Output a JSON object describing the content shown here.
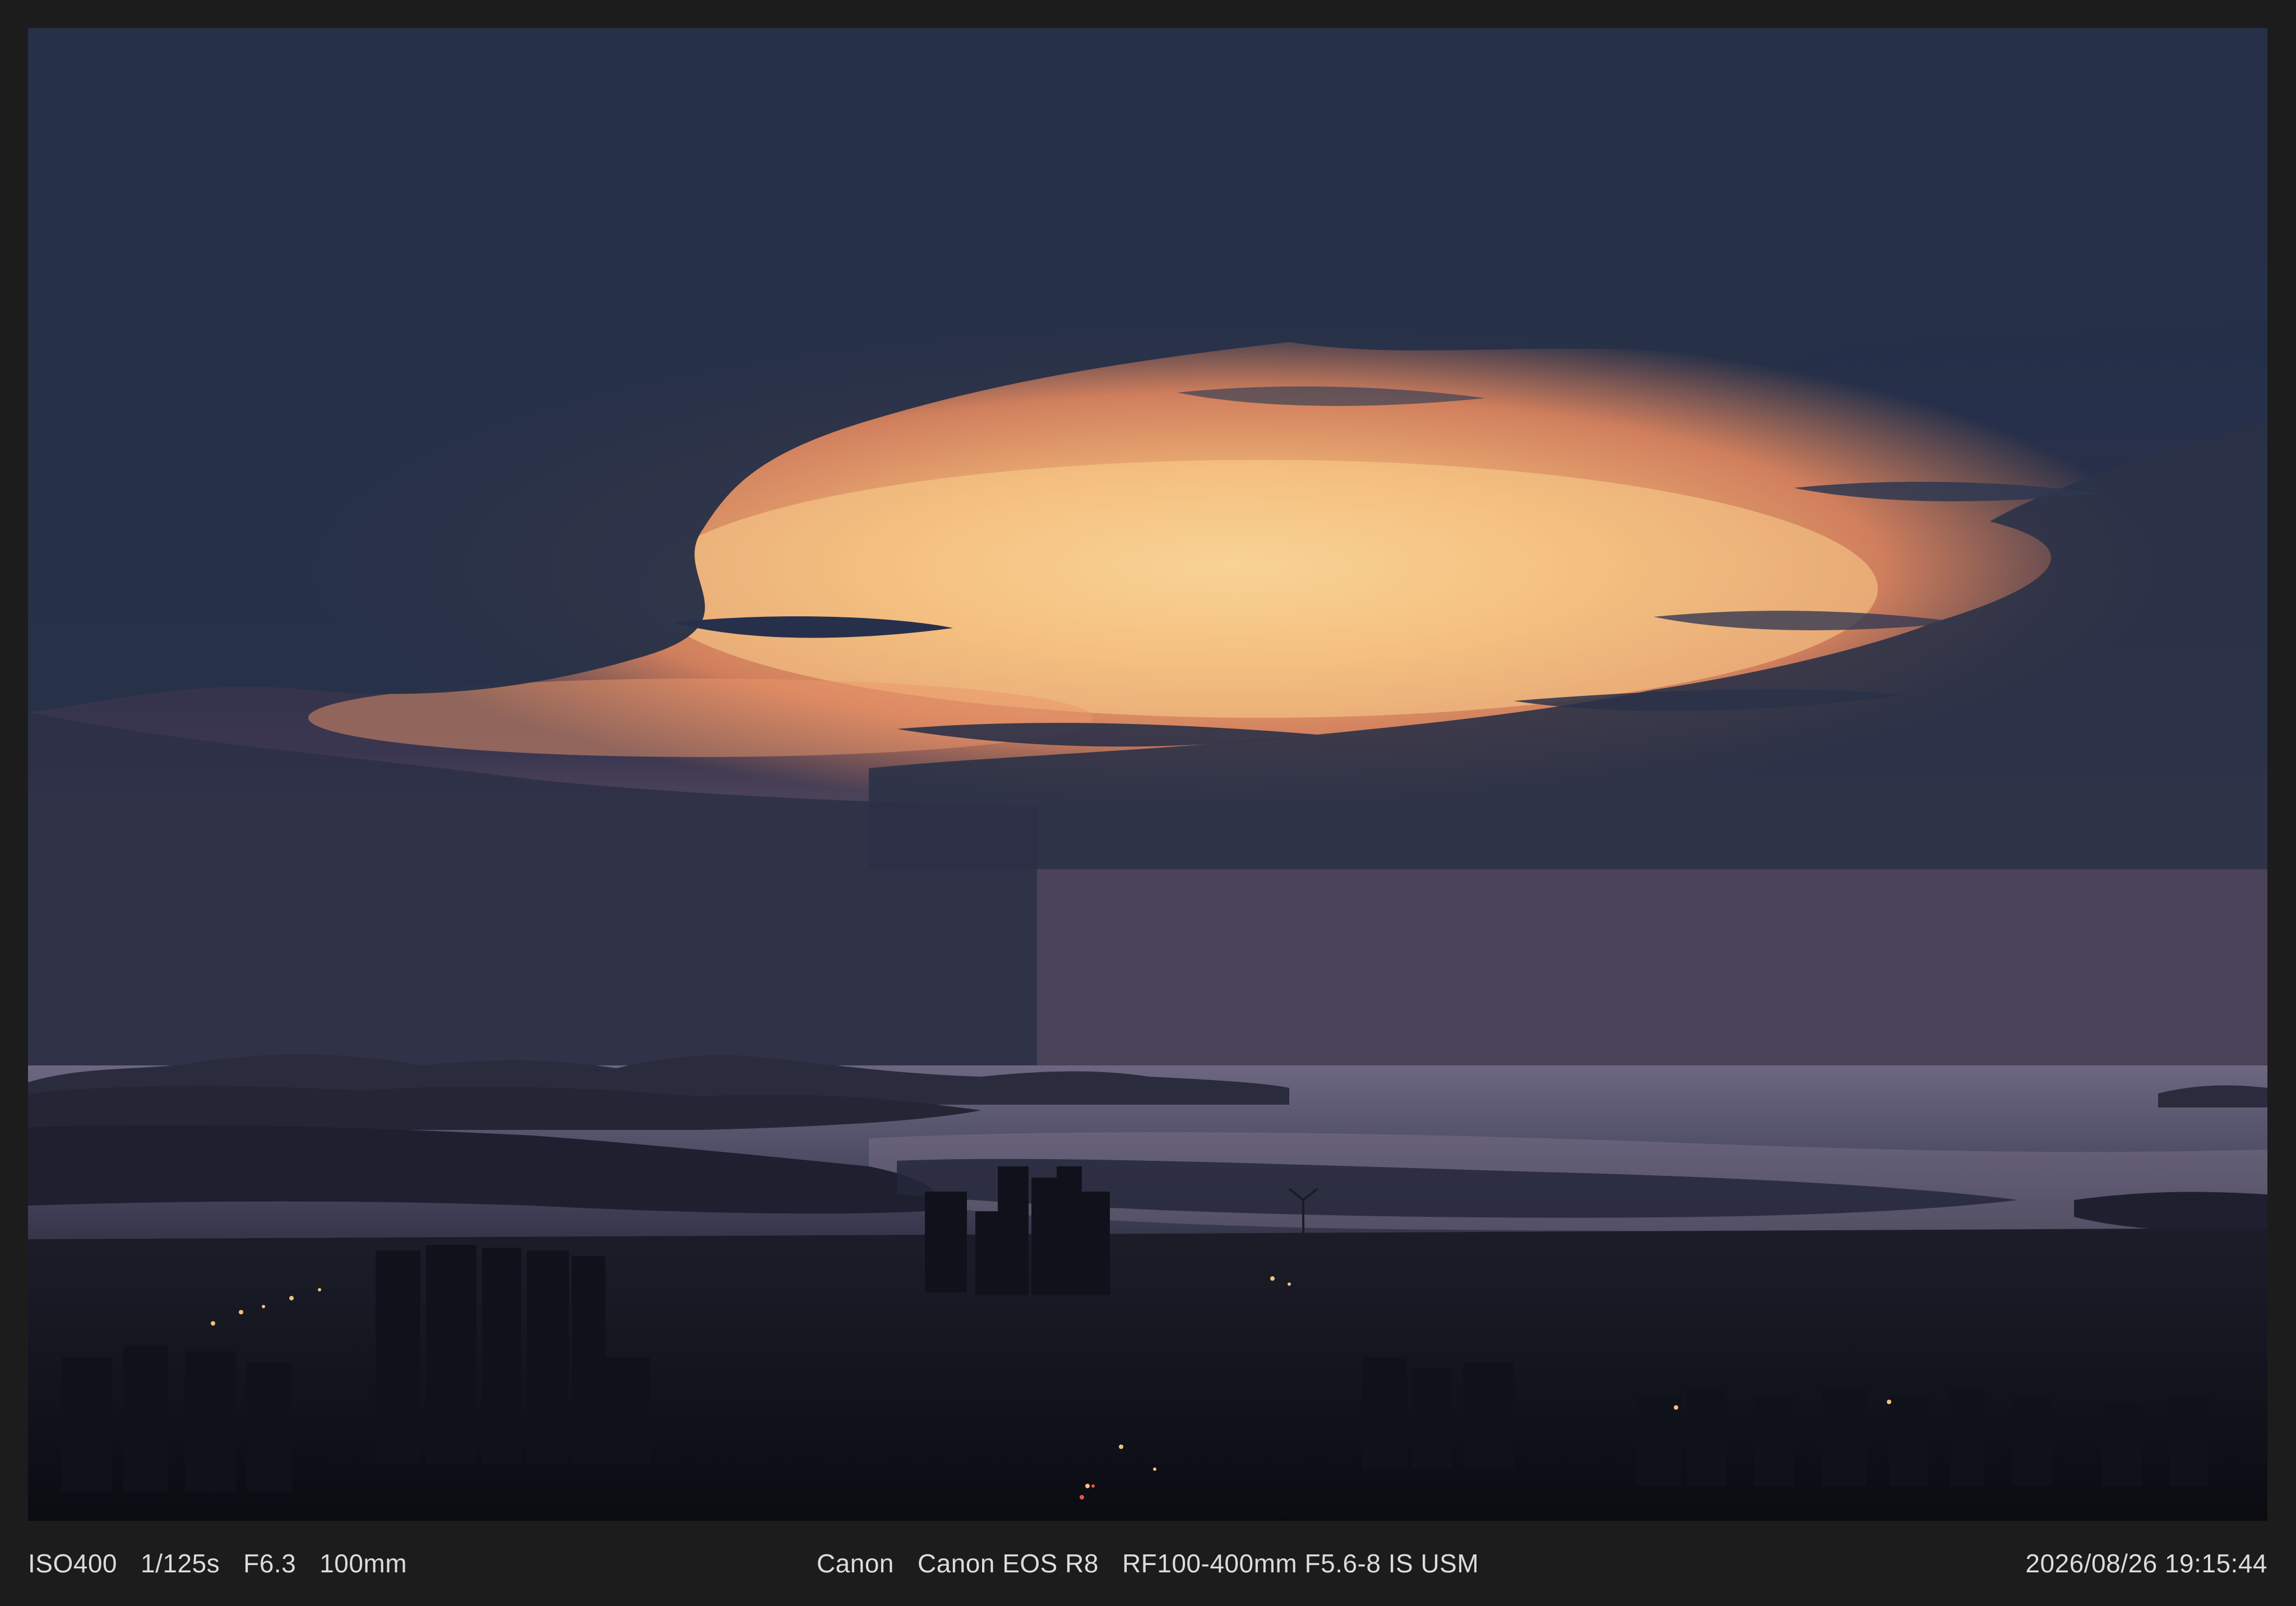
{
  "caption": {
    "iso": "ISO400",
    "shutter": "1/125s",
    "aperture": "F6.3",
    "focal_length": "100mm",
    "make": "Canon",
    "model": "Canon EOS R8",
    "lens": "RF100-400mm F5.6-8 IS USM",
    "datetime": "2026/08/26 19:15:44"
  },
  "colors": {
    "frame": "#1c1c1c",
    "caption_text": "#dcdcdc",
    "sky_dark": "#2a3247",
    "sunset_glow": "#f5b36a",
    "sea": "#5e5f78"
  }
}
